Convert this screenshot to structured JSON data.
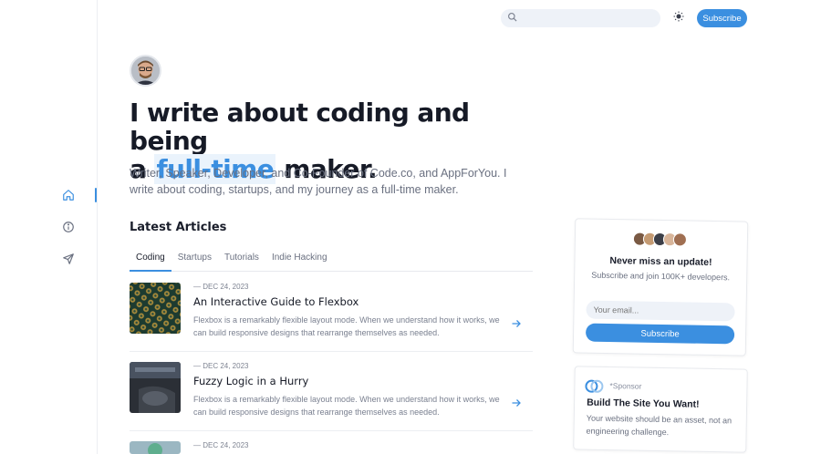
{
  "header": {
    "search_placeholder": "",
    "subscribe_label": "Subscribe"
  },
  "hero": {
    "title_line1": "I write about coding and being",
    "title_prefix": "a ",
    "title_highlight": "full-time",
    "title_suffix": " maker.",
    "subtitle": "Writer, Speaker, Developer, and Co-Founder of Code.co, and AppForYou. I write about coding, startups, and my journey as a full-time maker."
  },
  "articles": {
    "section_title": "Latest Articles",
    "tabs": [
      {
        "label": "Coding",
        "active": true
      },
      {
        "label": "Startups",
        "active": false
      },
      {
        "label": "Tutorials",
        "active": false
      },
      {
        "label": "Indie Hacking",
        "active": false
      }
    ],
    "items": [
      {
        "date": "— DEC 24, 2023",
        "title": "An Interactive Guide to Flexbox",
        "excerpt": "Flexbox is a remarkably flexible layout mode. When we understand how it works, we can build responsive designs that rearrange themselves as needed."
      },
      {
        "date": "— DEC 24, 2023",
        "title": "Fuzzy Logic in a Hurry",
        "excerpt": "Flexbox is a remarkably flexible layout mode. When we understand how it works, we can build responsive designs that rearrange themselves as needed."
      },
      {
        "date": "— DEC 24, 2023",
        "title": "",
        "excerpt": ""
      }
    ]
  },
  "newsletter": {
    "title": "Never miss an update!",
    "subtitle": "Subscribe and join 100K+ developers.",
    "email_placeholder": "Your email...",
    "button_label": "Subscribe"
  },
  "sponsor": {
    "tag": "*Sponsor",
    "title": "Build The Site You Want!",
    "text": "Your website should be an asset, not an engineering challenge."
  },
  "colors": {
    "accent": "#3b8fe0",
    "text_primary": "#161a26",
    "text_secondary": "#6a7080",
    "input_bg": "#eef2f8"
  },
  "icons": {
    "rail": [
      "home-icon",
      "info-icon",
      "send-icon"
    ],
    "search": "search-icon",
    "theme": "sun-icon",
    "article_arrow": "arrow-right-icon"
  }
}
